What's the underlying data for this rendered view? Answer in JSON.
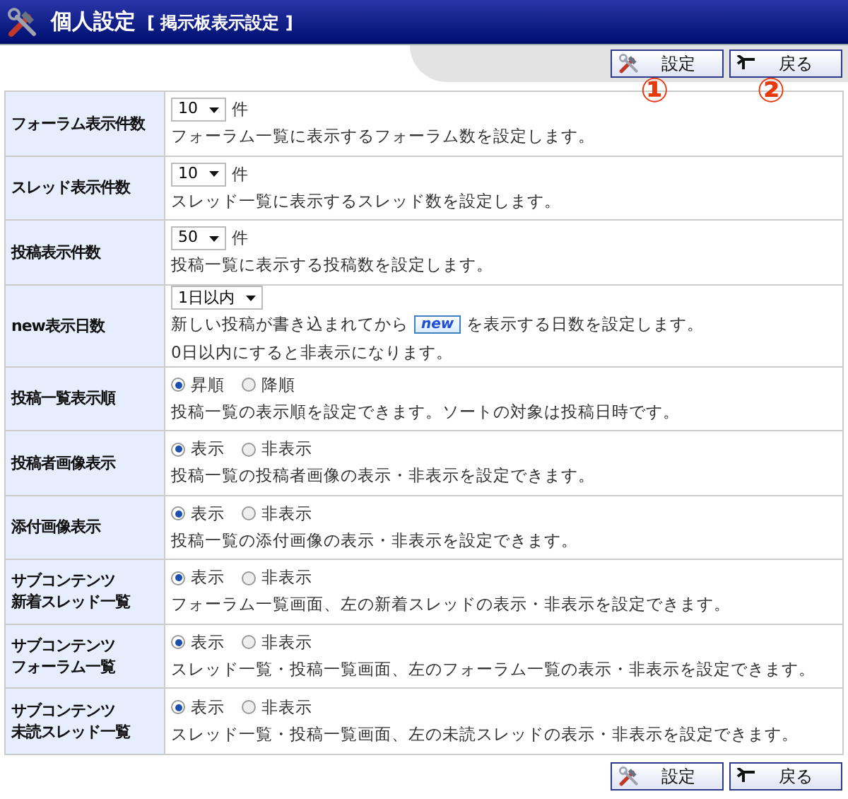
{
  "header": {
    "title": "個人設定",
    "subtitle": "[ 掲示板表示設定 ]"
  },
  "top_buttons": [
    {
      "kind": "settings",
      "label": "設定"
    },
    {
      "kind": "back",
      "label": "戻る"
    }
  ],
  "annotations": [
    "①",
    "②"
  ],
  "rows": [
    {
      "label": [
        "フォーラム表示件数"
      ],
      "kind": "select",
      "value": "10",
      "unit": "件",
      "description": [
        {
          "kind": "text",
          "text": "フォーラム一覧に表示するフォーラム数を設定します。"
        }
      ]
    },
    {
      "label": [
        "スレッド表示件数"
      ],
      "kind": "select",
      "value": "10",
      "unit": "件",
      "description": [
        {
          "kind": "text",
          "text": "スレッド一覧に表示するスレッド数を設定します。"
        }
      ]
    },
    {
      "label": [
        "投稿表示件数"
      ],
      "kind": "select",
      "value": "50",
      "unit": "件",
      "description": [
        {
          "kind": "text",
          "text": "投稿一覧に表示する投稿数を設定します。"
        }
      ]
    },
    {
      "label": [
        "new表示日数"
      ],
      "kind": "select",
      "value": "1日以内",
      "description": [
        {
          "kind": "text",
          "text": "新しい投稿が書き込まれてから"
        },
        {
          "kind": "badge",
          "text": "new"
        },
        {
          "kind": "text",
          "text": "を表示する日数を設定します。"
        }
      ],
      "note": "0日以内にすると非表示になります。"
    },
    {
      "label": [
        "投稿一覧表示順"
      ],
      "kind": "radio",
      "options": [
        {
          "label": "昇順",
          "selected": true
        },
        {
          "label": "降順",
          "selected": false
        }
      ],
      "description": [
        {
          "kind": "text",
          "text": "投稿一覧の表示順を設定できます。ソートの対象は投稿日時です。"
        }
      ]
    },
    {
      "label": [
        "投稿者画像表示"
      ],
      "kind": "radio",
      "options": [
        {
          "label": "表示",
          "selected": true
        },
        {
          "label": "非表示",
          "selected": false
        }
      ],
      "description": [
        {
          "kind": "text",
          "text": "投稿一覧の投稿者画像の表示・非表示を設定できます。"
        }
      ]
    },
    {
      "label": [
        "添付画像表示"
      ],
      "kind": "radio",
      "options": [
        {
          "label": "表示",
          "selected": true
        },
        {
          "label": "非表示",
          "selected": false
        }
      ],
      "description": [
        {
          "kind": "text",
          "text": "投稿一覧の添付画像の表示・非表示を設定できます。"
        }
      ]
    },
    {
      "label": [
        "サブコンテンツ",
        "新着スレッド一覧"
      ],
      "kind": "radio",
      "options": [
        {
          "label": "表示",
          "selected": true
        },
        {
          "label": "非表示",
          "selected": false
        }
      ],
      "description": [
        {
          "kind": "text",
          "text": "フォーラム一覧画面、左の新着スレッドの表示・非表示を設定できます。"
        }
      ]
    },
    {
      "label": [
        "サブコンテンツ",
        "フォーラム一覧"
      ],
      "kind": "radio",
      "options": [
        {
          "label": "表示",
          "selected": true
        },
        {
          "label": "非表示",
          "selected": false
        }
      ],
      "description": [
        {
          "kind": "text",
          "text": "スレッド一覧・投稿一覧画面、左のフォーラム一覧の表示・非表示を設定できます。"
        }
      ]
    },
    {
      "label": [
        "サブコンテンツ",
        "未読スレッド一覧"
      ],
      "kind": "radio",
      "options": [
        {
          "label": "表示",
          "selected": true
        },
        {
          "label": "非表示",
          "selected": false
        }
      ],
      "description": [
        {
          "kind": "text",
          "text": "スレッド一覧・投稿一覧画面、左の未読スレッドの表示・非表示を設定できます。"
        }
      ]
    }
  ],
  "bottom_buttons": [
    {
      "kind": "settings",
      "label": "設定"
    },
    {
      "kind": "back",
      "label": "戻る"
    }
  ]
}
